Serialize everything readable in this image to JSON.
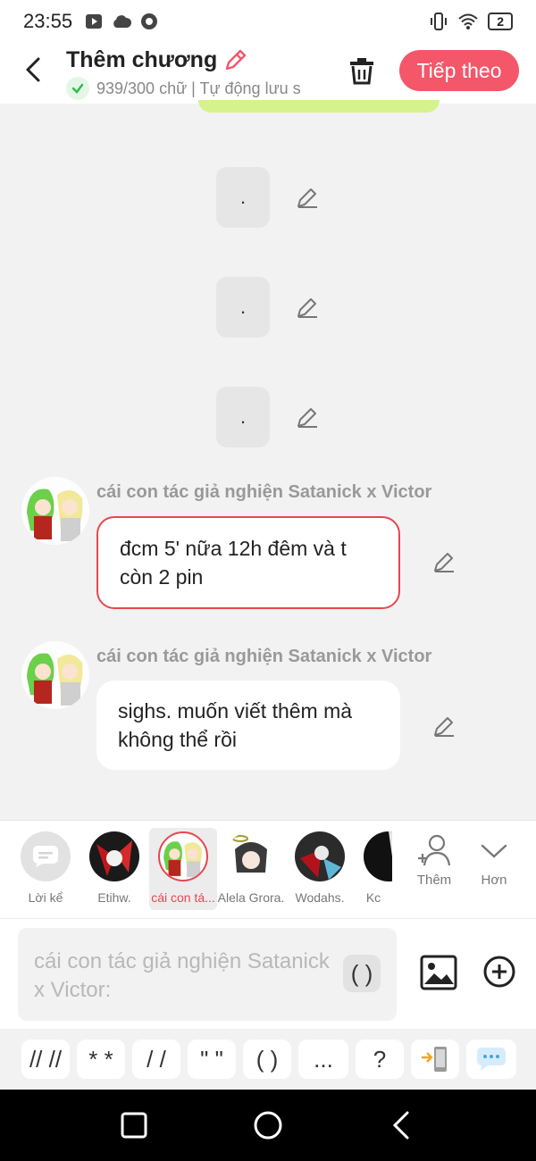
{
  "status_bar": {
    "time": "23:55",
    "battery": "2"
  },
  "header": {
    "title": "Thêm chương",
    "subtitle": "939/300 chữ | Tự động lưu s",
    "next_label": "Tiếp theo"
  },
  "chat": {
    "dots": [
      ".",
      ".",
      "."
    ],
    "messages": [
      {
        "author": "cái con tác giả nghiện Satanick x Victor",
        "text": "đcm 5' nữa 12h đêm và t còn 2 pin"
      },
      {
        "author": "cái con tác giả nghiện Satanick x Victor",
        "text": "sighs. muốn viết thêm mà không thể rồi"
      }
    ]
  },
  "characters": [
    {
      "name": "Lời kể"
    },
    {
      "name": "Etihw."
    },
    {
      "name": "cái con tá..."
    },
    {
      "name": "Alela Grora."
    },
    {
      "name": "Wodahs."
    },
    {
      "name": "Kc"
    }
  ],
  "char_actions": {
    "add_label": "Thêm",
    "more_label": "Hơn"
  },
  "composer": {
    "placeholder": "cái con tác giả nghiện Satanick x Victor:",
    "paren_chip": "( )"
  },
  "shortcuts": [
    "// //",
    "* *",
    "/ /",
    "\" \"",
    "( )",
    "...",
    "?"
  ],
  "colors": {
    "accent": "#f4566a",
    "selection_border": "#e8464f",
    "verified": "#2dbb4f",
    "status_strip": "#d6f28d"
  }
}
